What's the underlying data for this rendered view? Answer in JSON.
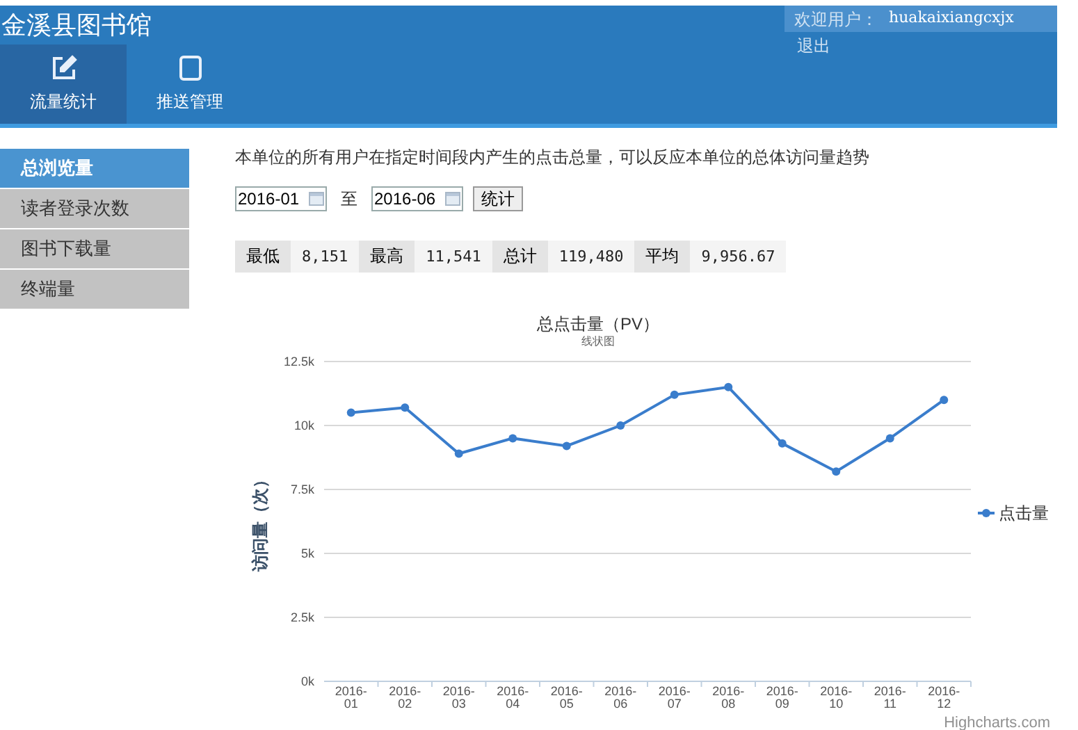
{
  "header": {
    "title": "金溪县图书馆",
    "welcome_label": "欢迎用户：",
    "username": "huakaixiangcxjx",
    "logout": "退出"
  },
  "nav": [
    {
      "label": "流量统计",
      "selected": true
    },
    {
      "label": "推送管理",
      "selected": false
    }
  ],
  "sidebar": [
    {
      "label": "总浏览量",
      "selected": true
    },
    {
      "label": "读者登录次数",
      "selected": false
    },
    {
      "label": "图书下载量",
      "selected": false
    },
    {
      "label": "终端量",
      "selected": false
    }
  ],
  "description": "本单位的所有用户在指定时间段内产生的点击总量，可以反应本单位的总体访问量趋势",
  "range": {
    "start": "2016-01",
    "separator": "至",
    "end": "2016-06",
    "button": "统计"
  },
  "stats": [
    {
      "label": "最低",
      "value": "8,151"
    },
    {
      "label": "最高",
      "value": "11,541"
    },
    {
      "label": "总计",
      "value": "119,480"
    },
    {
      "label": "平均",
      "value": "9,956.67"
    }
  ],
  "chart": {
    "chart_data": {
      "type": "line",
      "title": "总点击量（PV）",
      "subtitle": "线状图",
      "ylabel": "访问量（次）",
      "categories": [
        "2016-01",
        "2016-02",
        "2016-03",
        "2016-04",
        "2016-05",
        "2016-06",
        "2016-07",
        "2016-08",
        "2016-09",
        "2016-10",
        "2016-11",
        "2016-12"
      ],
      "series": [
        {
          "name": "点击量",
          "color": "#3a7dcc",
          "marker": true,
          "values": [
            10500,
            10700,
            8900,
            9500,
            9200,
            10000,
            11200,
            11500,
            9300,
            8200,
            9500,
            11000
          ]
        }
      ],
      "grid": true,
      "ylim": [
        0,
        12500
      ],
      "yticks": [
        {
          "value": 0,
          "label": "0k"
        },
        {
          "value": 2500,
          "label": "2.5k"
        },
        {
          "value": 5000,
          "label": "5k"
        },
        {
          "value": 7500,
          "label": "7.5k"
        },
        {
          "value": 10000,
          "label": "10k"
        },
        {
          "value": 12500,
          "label": "12.5k"
        }
      ]
    },
    "credit": "Highcharts.com"
  }
}
